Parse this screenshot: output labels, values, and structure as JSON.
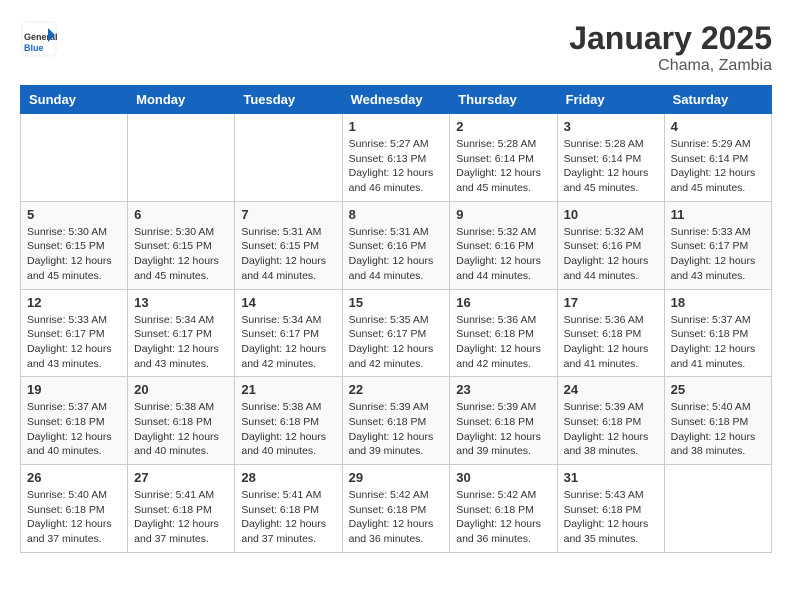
{
  "header": {
    "logo_general": "General",
    "logo_blue": "Blue",
    "month": "January 2025",
    "location": "Chama, Zambia"
  },
  "weekdays": [
    "Sunday",
    "Monday",
    "Tuesday",
    "Wednesday",
    "Thursday",
    "Friday",
    "Saturday"
  ],
  "weeks": [
    [
      {
        "day": "",
        "sunrise": "",
        "sunset": "",
        "daylight": ""
      },
      {
        "day": "",
        "sunrise": "",
        "sunset": "",
        "daylight": ""
      },
      {
        "day": "",
        "sunrise": "",
        "sunset": "",
        "daylight": ""
      },
      {
        "day": "1",
        "sunrise": "Sunrise: 5:27 AM",
        "sunset": "Sunset: 6:13 PM",
        "daylight": "Daylight: 12 hours and 46 minutes."
      },
      {
        "day": "2",
        "sunrise": "Sunrise: 5:28 AM",
        "sunset": "Sunset: 6:14 PM",
        "daylight": "Daylight: 12 hours and 45 minutes."
      },
      {
        "day": "3",
        "sunrise": "Sunrise: 5:28 AM",
        "sunset": "Sunset: 6:14 PM",
        "daylight": "Daylight: 12 hours and 45 minutes."
      },
      {
        "day": "4",
        "sunrise": "Sunrise: 5:29 AM",
        "sunset": "Sunset: 6:14 PM",
        "daylight": "Daylight: 12 hours and 45 minutes."
      }
    ],
    [
      {
        "day": "5",
        "sunrise": "Sunrise: 5:30 AM",
        "sunset": "Sunset: 6:15 PM",
        "daylight": "Daylight: 12 hours and 45 minutes."
      },
      {
        "day": "6",
        "sunrise": "Sunrise: 5:30 AM",
        "sunset": "Sunset: 6:15 PM",
        "daylight": "Daylight: 12 hours and 45 minutes."
      },
      {
        "day": "7",
        "sunrise": "Sunrise: 5:31 AM",
        "sunset": "Sunset: 6:15 PM",
        "daylight": "Daylight: 12 hours and 44 minutes."
      },
      {
        "day": "8",
        "sunrise": "Sunrise: 5:31 AM",
        "sunset": "Sunset: 6:16 PM",
        "daylight": "Daylight: 12 hours and 44 minutes."
      },
      {
        "day": "9",
        "sunrise": "Sunrise: 5:32 AM",
        "sunset": "Sunset: 6:16 PM",
        "daylight": "Daylight: 12 hours and 44 minutes."
      },
      {
        "day": "10",
        "sunrise": "Sunrise: 5:32 AM",
        "sunset": "Sunset: 6:16 PM",
        "daylight": "Daylight: 12 hours and 44 minutes."
      },
      {
        "day": "11",
        "sunrise": "Sunrise: 5:33 AM",
        "sunset": "Sunset: 6:17 PM",
        "daylight": "Daylight: 12 hours and 43 minutes."
      }
    ],
    [
      {
        "day": "12",
        "sunrise": "Sunrise: 5:33 AM",
        "sunset": "Sunset: 6:17 PM",
        "daylight": "Daylight: 12 hours and 43 minutes."
      },
      {
        "day": "13",
        "sunrise": "Sunrise: 5:34 AM",
        "sunset": "Sunset: 6:17 PM",
        "daylight": "Daylight: 12 hours and 43 minutes."
      },
      {
        "day": "14",
        "sunrise": "Sunrise: 5:34 AM",
        "sunset": "Sunset: 6:17 PM",
        "daylight": "Daylight: 12 hours and 42 minutes."
      },
      {
        "day": "15",
        "sunrise": "Sunrise: 5:35 AM",
        "sunset": "Sunset: 6:17 PM",
        "daylight": "Daylight: 12 hours and 42 minutes."
      },
      {
        "day": "16",
        "sunrise": "Sunrise: 5:36 AM",
        "sunset": "Sunset: 6:18 PM",
        "daylight": "Daylight: 12 hours and 42 minutes."
      },
      {
        "day": "17",
        "sunrise": "Sunrise: 5:36 AM",
        "sunset": "Sunset: 6:18 PM",
        "daylight": "Daylight: 12 hours and 41 minutes."
      },
      {
        "day": "18",
        "sunrise": "Sunrise: 5:37 AM",
        "sunset": "Sunset: 6:18 PM",
        "daylight": "Daylight: 12 hours and 41 minutes."
      }
    ],
    [
      {
        "day": "19",
        "sunrise": "Sunrise: 5:37 AM",
        "sunset": "Sunset: 6:18 PM",
        "daylight": "Daylight: 12 hours and 40 minutes."
      },
      {
        "day": "20",
        "sunrise": "Sunrise: 5:38 AM",
        "sunset": "Sunset: 6:18 PM",
        "daylight": "Daylight: 12 hours and 40 minutes."
      },
      {
        "day": "21",
        "sunrise": "Sunrise: 5:38 AM",
        "sunset": "Sunset: 6:18 PM",
        "daylight": "Daylight: 12 hours and 40 minutes."
      },
      {
        "day": "22",
        "sunrise": "Sunrise: 5:39 AM",
        "sunset": "Sunset: 6:18 PM",
        "daylight": "Daylight: 12 hours and 39 minutes."
      },
      {
        "day": "23",
        "sunrise": "Sunrise: 5:39 AM",
        "sunset": "Sunset: 6:18 PM",
        "daylight": "Daylight: 12 hours and 39 minutes."
      },
      {
        "day": "24",
        "sunrise": "Sunrise: 5:39 AM",
        "sunset": "Sunset: 6:18 PM",
        "daylight": "Daylight: 12 hours and 38 minutes."
      },
      {
        "day": "25",
        "sunrise": "Sunrise: 5:40 AM",
        "sunset": "Sunset: 6:18 PM",
        "daylight": "Daylight: 12 hours and 38 minutes."
      }
    ],
    [
      {
        "day": "26",
        "sunrise": "Sunrise: 5:40 AM",
        "sunset": "Sunset: 6:18 PM",
        "daylight": "Daylight: 12 hours and 37 minutes."
      },
      {
        "day": "27",
        "sunrise": "Sunrise: 5:41 AM",
        "sunset": "Sunset: 6:18 PM",
        "daylight": "Daylight: 12 hours and 37 minutes."
      },
      {
        "day": "28",
        "sunrise": "Sunrise: 5:41 AM",
        "sunset": "Sunset: 6:18 PM",
        "daylight": "Daylight: 12 hours and 37 minutes."
      },
      {
        "day": "29",
        "sunrise": "Sunrise: 5:42 AM",
        "sunset": "Sunset: 6:18 PM",
        "daylight": "Daylight: 12 hours and 36 minutes."
      },
      {
        "day": "30",
        "sunrise": "Sunrise: 5:42 AM",
        "sunset": "Sunset: 6:18 PM",
        "daylight": "Daylight: 12 hours and 36 minutes."
      },
      {
        "day": "31",
        "sunrise": "Sunrise: 5:43 AM",
        "sunset": "Sunset: 6:18 PM",
        "daylight": "Daylight: 12 hours and 35 minutes."
      },
      {
        "day": "",
        "sunrise": "",
        "sunset": "",
        "daylight": ""
      }
    ]
  ]
}
